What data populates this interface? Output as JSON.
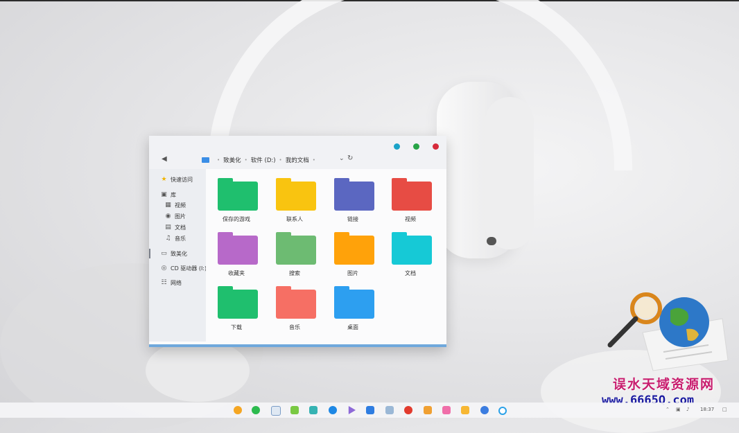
{
  "window": {
    "breadcrumb": [
      "致美化",
      "软件 (D:)",
      "我的文档"
    ],
    "controls": {
      "minimize_color": "#1aa3c8",
      "maximize_color": "#27a447",
      "close_color": "#d62a3b"
    }
  },
  "sidebar": {
    "items": [
      {
        "label": "快速访问",
        "icon": "star-icon"
      },
      {
        "label": "库",
        "icon": "library-icon"
      },
      {
        "label": "视频",
        "icon": "video-icon"
      },
      {
        "label": "图片",
        "icon": "image-icon"
      },
      {
        "label": "文档",
        "icon": "document-icon"
      },
      {
        "label": "音乐",
        "icon": "music-icon"
      },
      {
        "label": "致美化",
        "icon": "computer-icon"
      },
      {
        "label": "CD 驱动器 (I:)",
        "icon": "cd-drive-icon"
      },
      {
        "label": "网络",
        "icon": "network-icon"
      }
    ]
  },
  "folders": [
    {
      "label": "保存的游戏",
      "color": "#1fbf6e"
    },
    {
      "label": "联系人",
      "color": "#f9c410"
    },
    {
      "label": "链接",
      "color": "#5b67c1"
    },
    {
      "label": "视频",
      "color": "#e74c44"
    },
    {
      "label": "收藏夹",
      "color": "#b769c9"
    },
    {
      "label": "搜索",
      "color": "#6dbb72"
    },
    {
      "label": "图片",
      "color": "#ffa20a"
    },
    {
      "label": "文档",
      "color": "#16c9d6"
    },
    {
      "label": "下载",
      "color": "#1fbf6e"
    },
    {
      "label": "音乐",
      "color": "#f66f64"
    },
    {
      "label": "桌面",
      "color": "#2d9ff0"
    }
  ],
  "taskbar": {
    "clock": "18:37"
  },
  "watermark": {
    "title": "误水天域资源网",
    "url": "www.6665Q.com"
  }
}
